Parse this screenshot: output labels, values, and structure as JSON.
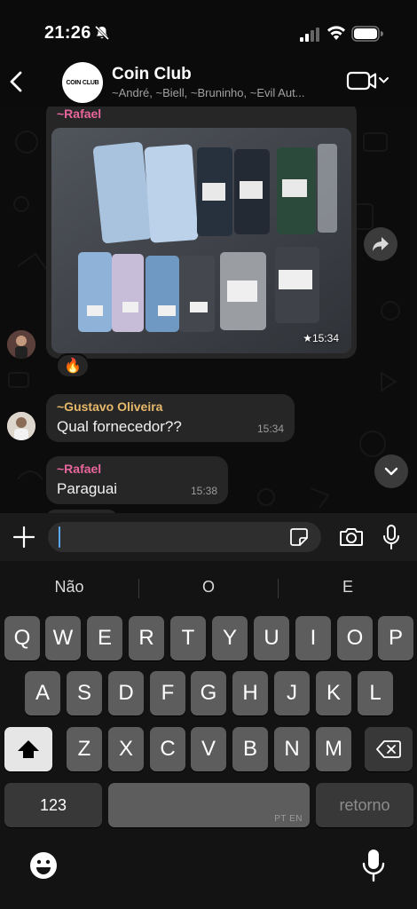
{
  "status_bar": {
    "time": "21:26"
  },
  "header": {
    "back_icon": "chevron-left-icon",
    "avatar_text": "COIN CLUB",
    "title": "Coin Club",
    "members": "~André, ~Biell, ~Bruninho, ~Evil Aut..."
  },
  "messages": [
    {
      "sender": "~Rafael",
      "type": "image",
      "time": "★15:34",
      "reaction": "🔥"
    },
    {
      "sender": "~Gustavo Oliveira",
      "text": "Qual fornecedor??",
      "time": "15:34"
    },
    {
      "sender": "~Rafael",
      "text": "Paraguai",
      "time": "15:38"
    }
  ],
  "input": {
    "placeholder": ""
  },
  "keyboard": {
    "suggestions": [
      "Não",
      "O",
      "E"
    ],
    "row1": [
      "Q",
      "W",
      "E",
      "R",
      "T",
      "Y",
      "U",
      "I",
      "O",
      "P"
    ],
    "row2": [
      "A",
      "S",
      "D",
      "F",
      "G",
      "H",
      "J",
      "K",
      "L"
    ],
    "row3": [
      "Z",
      "X",
      "C",
      "V",
      "B",
      "N",
      "M"
    ],
    "numbers_key": "123",
    "space_lang": "PT EN",
    "return_key": "retorno"
  },
  "colors": {
    "sender_pink": "#e9669c",
    "sender_yellow": "#e7b96a",
    "bubble": "#262626",
    "cursor": "#5aa8ff"
  }
}
